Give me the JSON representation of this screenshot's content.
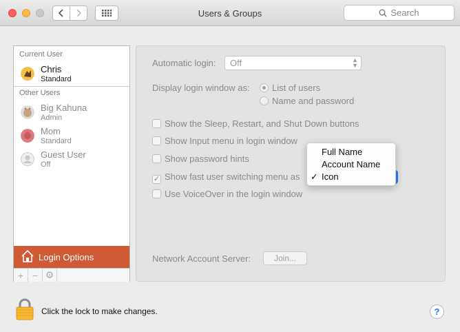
{
  "window": {
    "title": "Users & Groups"
  },
  "search": {
    "placeholder": "Search"
  },
  "sidebar": {
    "current_user_header": "Current User",
    "current_user": {
      "name": "Chris",
      "role": "Standard"
    },
    "other_users_header": "Other Users",
    "other_users": [
      {
        "name": "Big Kahuna",
        "role": "Admin"
      },
      {
        "name": "Mom",
        "role": "Standard"
      },
      {
        "name": "Guest User",
        "role": "Off"
      }
    ],
    "login_options_label": "Login Options"
  },
  "panel": {
    "automatic_login_label": "Automatic login:",
    "automatic_login_value": "Off",
    "display_login_label": "Display login window as:",
    "radio_list": "List of users",
    "radio_name": "Name and password",
    "show_sleep": "Show the Sleep, Restart, and Shut Down buttons",
    "show_input": "Show Input menu in login window",
    "show_hints": "Show password hints",
    "show_fast_switch": "Show fast user switching menu as",
    "use_voiceover": "Use VoiceOver in the login window",
    "network_label": "Network Account Server:",
    "join_label": "Join..."
  },
  "popup_menu": {
    "items": [
      "Full Name",
      "Account Name",
      "Icon"
    ],
    "selected": "Icon"
  },
  "footer": {
    "lock_text": "Click the lock to make changes.",
    "help_label": "?"
  },
  "colors": {
    "login_options_bg": "#cf5a36",
    "accent": "#2c7df6"
  }
}
